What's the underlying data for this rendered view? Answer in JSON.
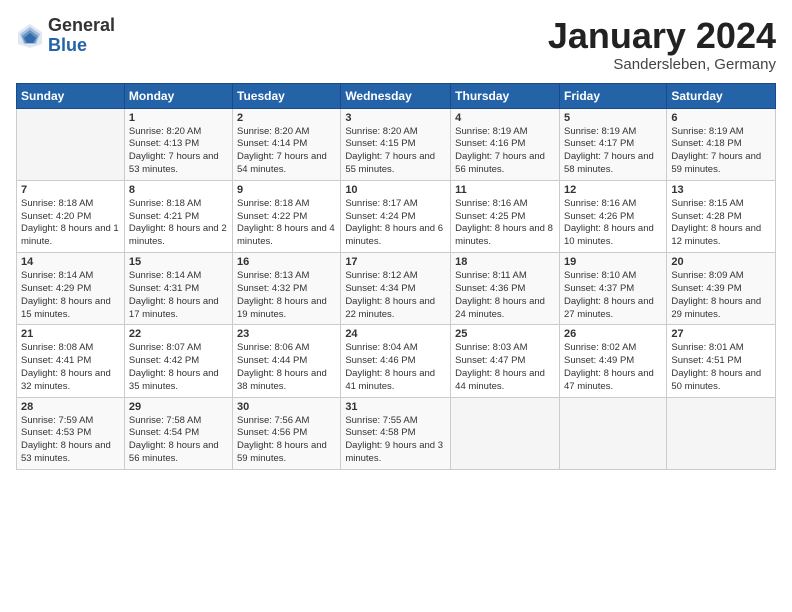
{
  "header": {
    "logo_general": "General",
    "logo_blue": "Blue",
    "month_title": "January 2024",
    "location": "Sandersleben, Germany"
  },
  "columns": [
    "Sunday",
    "Monday",
    "Tuesday",
    "Wednesday",
    "Thursday",
    "Friday",
    "Saturday"
  ],
  "weeks": [
    [
      {
        "day": "",
        "sunrise": "",
        "sunset": "",
        "daylight": ""
      },
      {
        "day": "1",
        "sunrise": "Sunrise: 8:20 AM",
        "sunset": "Sunset: 4:13 PM",
        "daylight": "Daylight: 7 hours and 53 minutes."
      },
      {
        "day": "2",
        "sunrise": "Sunrise: 8:20 AM",
        "sunset": "Sunset: 4:14 PM",
        "daylight": "Daylight: 7 hours and 54 minutes."
      },
      {
        "day": "3",
        "sunrise": "Sunrise: 8:20 AM",
        "sunset": "Sunset: 4:15 PM",
        "daylight": "Daylight: 7 hours and 55 minutes."
      },
      {
        "day": "4",
        "sunrise": "Sunrise: 8:19 AM",
        "sunset": "Sunset: 4:16 PM",
        "daylight": "Daylight: 7 hours and 56 minutes."
      },
      {
        "day": "5",
        "sunrise": "Sunrise: 8:19 AM",
        "sunset": "Sunset: 4:17 PM",
        "daylight": "Daylight: 7 hours and 58 minutes."
      },
      {
        "day": "6",
        "sunrise": "Sunrise: 8:19 AM",
        "sunset": "Sunset: 4:18 PM",
        "daylight": "Daylight: 7 hours and 59 minutes."
      }
    ],
    [
      {
        "day": "7",
        "sunrise": "Sunrise: 8:18 AM",
        "sunset": "Sunset: 4:20 PM",
        "daylight": "Daylight: 8 hours and 1 minute."
      },
      {
        "day": "8",
        "sunrise": "Sunrise: 8:18 AM",
        "sunset": "Sunset: 4:21 PM",
        "daylight": "Daylight: 8 hours and 2 minutes."
      },
      {
        "day": "9",
        "sunrise": "Sunrise: 8:18 AM",
        "sunset": "Sunset: 4:22 PM",
        "daylight": "Daylight: 8 hours and 4 minutes."
      },
      {
        "day": "10",
        "sunrise": "Sunrise: 8:17 AM",
        "sunset": "Sunset: 4:24 PM",
        "daylight": "Daylight: 8 hours and 6 minutes."
      },
      {
        "day": "11",
        "sunrise": "Sunrise: 8:16 AM",
        "sunset": "Sunset: 4:25 PM",
        "daylight": "Daylight: 8 hours and 8 minutes."
      },
      {
        "day": "12",
        "sunrise": "Sunrise: 8:16 AM",
        "sunset": "Sunset: 4:26 PM",
        "daylight": "Daylight: 8 hours and 10 minutes."
      },
      {
        "day": "13",
        "sunrise": "Sunrise: 8:15 AM",
        "sunset": "Sunset: 4:28 PM",
        "daylight": "Daylight: 8 hours and 12 minutes."
      }
    ],
    [
      {
        "day": "14",
        "sunrise": "Sunrise: 8:14 AM",
        "sunset": "Sunset: 4:29 PM",
        "daylight": "Daylight: 8 hours and 15 minutes."
      },
      {
        "day": "15",
        "sunrise": "Sunrise: 8:14 AM",
        "sunset": "Sunset: 4:31 PM",
        "daylight": "Daylight: 8 hours and 17 minutes."
      },
      {
        "day": "16",
        "sunrise": "Sunrise: 8:13 AM",
        "sunset": "Sunset: 4:32 PM",
        "daylight": "Daylight: 8 hours and 19 minutes."
      },
      {
        "day": "17",
        "sunrise": "Sunrise: 8:12 AM",
        "sunset": "Sunset: 4:34 PM",
        "daylight": "Daylight: 8 hours and 22 minutes."
      },
      {
        "day": "18",
        "sunrise": "Sunrise: 8:11 AM",
        "sunset": "Sunset: 4:36 PM",
        "daylight": "Daylight: 8 hours and 24 minutes."
      },
      {
        "day": "19",
        "sunrise": "Sunrise: 8:10 AM",
        "sunset": "Sunset: 4:37 PM",
        "daylight": "Daylight: 8 hours and 27 minutes."
      },
      {
        "day": "20",
        "sunrise": "Sunrise: 8:09 AM",
        "sunset": "Sunset: 4:39 PM",
        "daylight": "Daylight: 8 hours and 29 minutes."
      }
    ],
    [
      {
        "day": "21",
        "sunrise": "Sunrise: 8:08 AM",
        "sunset": "Sunset: 4:41 PM",
        "daylight": "Daylight: 8 hours and 32 minutes."
      },
      {
        "day": "22",
        "sunrise": "Sunrise: 8:07 AM",
        "sunset": "Sunset: 4:42 PM",
        "daylight": "Daylight: 8 hours and 35 minutes."
      },
      {
        "day": "23",
        "sunrise": "Sunrise: 8:06 AM",
        "sunset": "Sunset: 4:44 PM",
        "daylight": "Daylight: 8 hours and 38 minutes."
      },
      {
        "day": "24",
        "sunrise": "Sunrise: 8:04 AM",
        "sunset": "Sunset: 4:46 PM",
        "daylight": "Daylight: 8 hours and 41 minutes."
      },
      {
        "day": "25",
        "sunrise": "Sunrise: 8:03 AM",
        "sunset": "Sunset: 4:47 PM",
        "daylight": "Daylight: 8 hours and 44 minutes."
      },
      {
        "day": "26",
        "sunrise": "Sunrise: 8:02 AM",
        "sunset": "Sunset: 4:49 PM",
        "daylight": "Daylight: 8 hours and 47 minutes."
      },
      {
        "day": "27",
        "sunrise": "Sunrise: 8:01 AM",
        "sunset": "Sunset: 4:51 PM",
        "daylight": "Daylight: 8 hours and 50 minutes."
      }
    ],
    [
      {
        "day": "28",
        "sunrise": "Sunrise: 7:59 AM",
        "sunset": "Sunset: 4:53 PM",
        "daylight": "Daylight: 8 hours and 53 minutes."
      },
      {
        "day": "29",
        "sunrise": "Sunrise: 7:58 AM",
        "sunset": "Sunset: 4:54 PM",
        "daylight": "Daylight: 8 hours and 56 minutes."
      },
      {
        "day": "30",
        "sunrise": "Sunrise: 7:56 AM",
        "sunset": "Sunset: 4:56 PM",
        "daylight": "Daylight: 8 hours and 59 minutes."
      },
      {
        "day": "31",
        "sunrise": "Sunrise: 7:55 AM",
        "sunset": "Sunset: 4:58 PM",
        "daylight": "Daylight: 9 hours and 3 minutes."
      },
      {
        "day": "",
        "sunrise": "",
        "sunset": "",
        "daylight": ""
      },
      {
        "day": "",
        "sunrise": "",
        "sunset": "",
        "daylight": ""
      },
      {
        "day": "",
        "sunrise": "",
        "sunset": "",
        "daylight": ""
      }
    ]
  ]
}
